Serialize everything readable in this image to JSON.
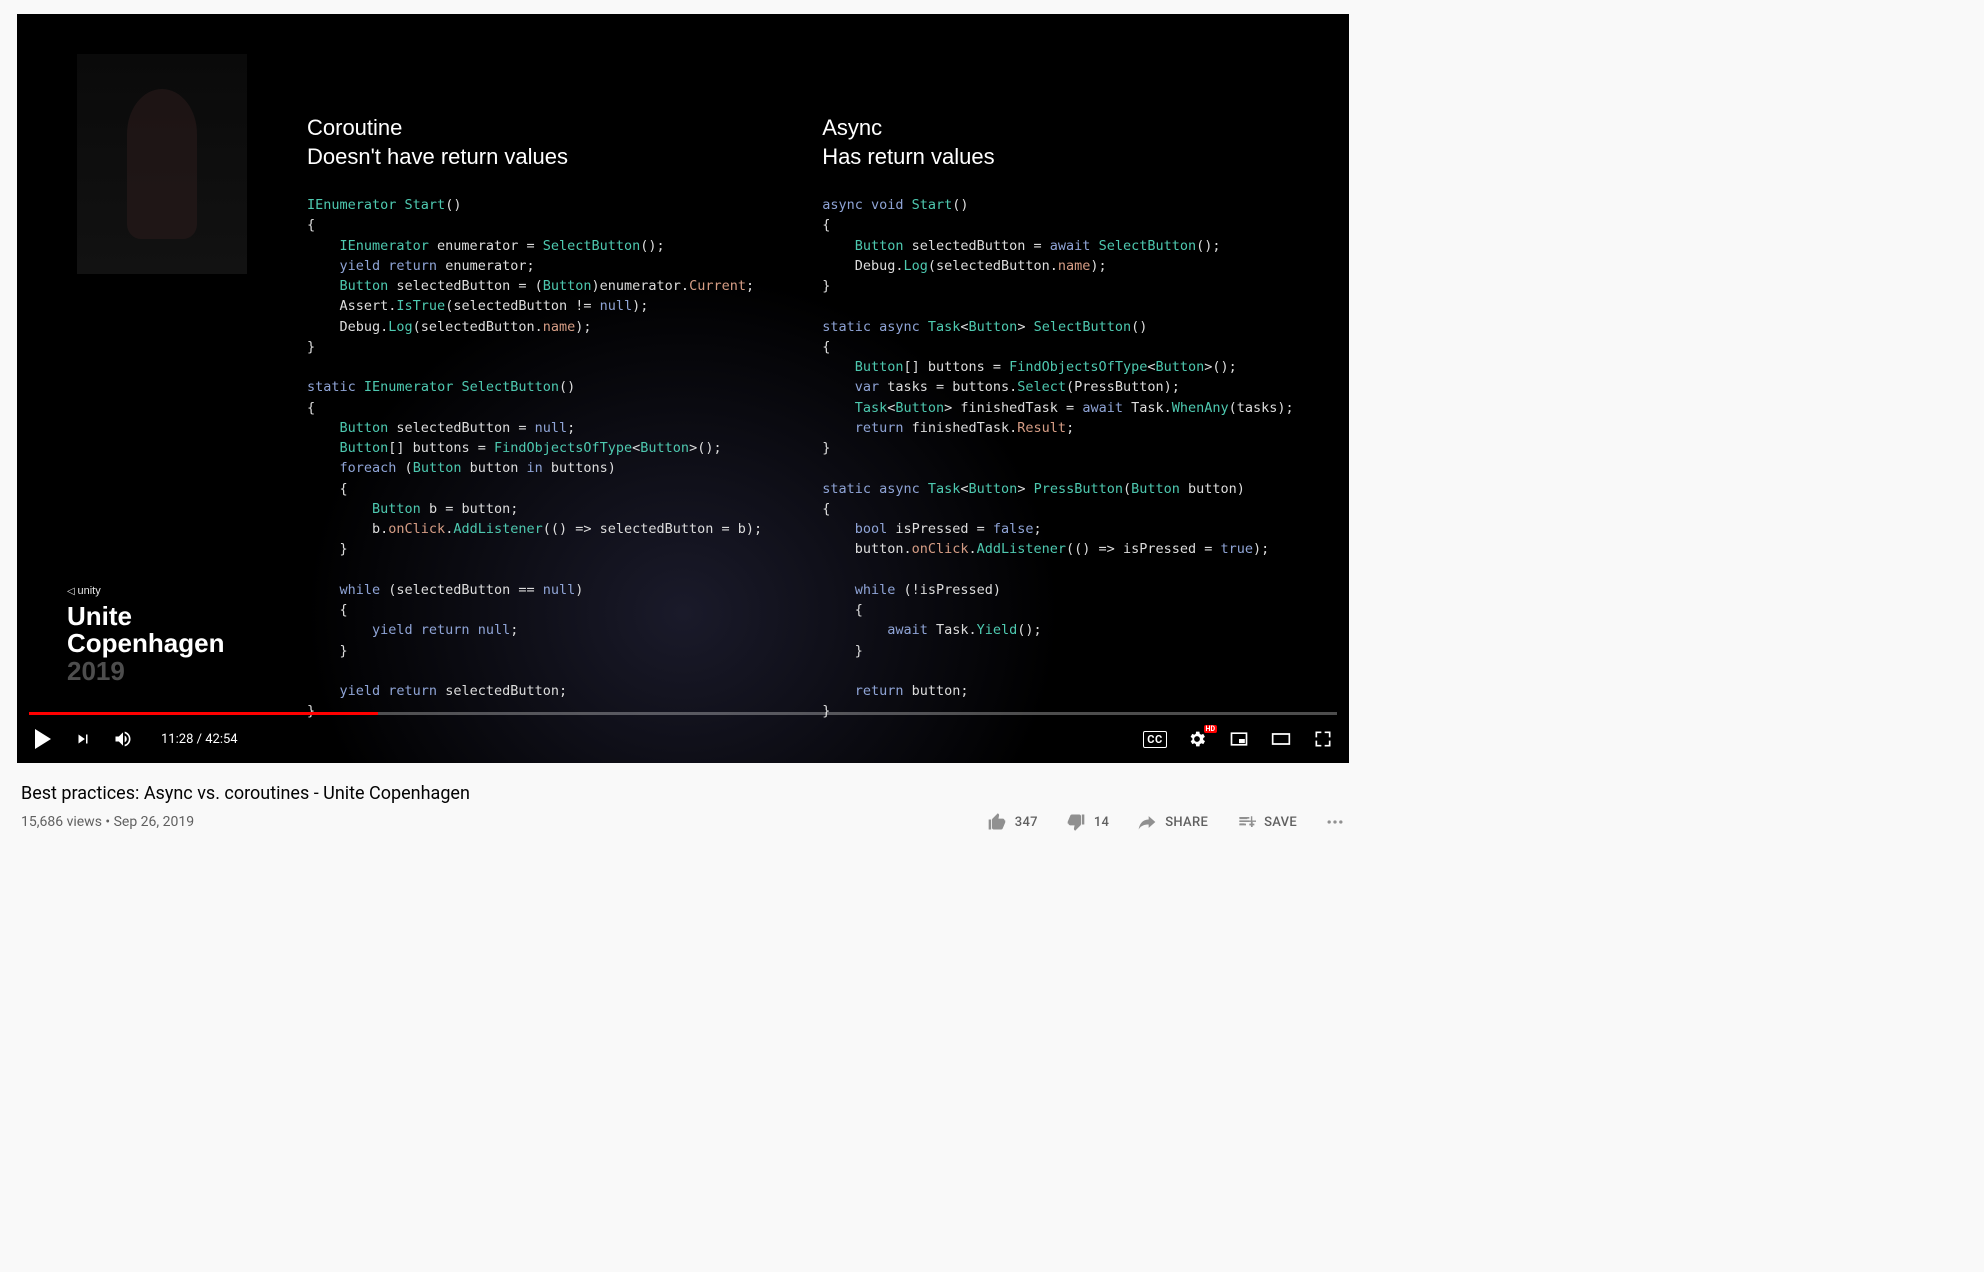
{
  "player": {
    "time_current": "11:28",
    "time_total": "42:54",
    "progress_pct": 26.7,
    "cc_label": "CC"
  },
  "slide": {
    "left_title": "Coroutine",
    "left_subtitle": "Doesn't have return values",
    "right_title": "Async",
    "right_subtitle": "Has return values",
    "code_left": "IEnumerator Start()\n{\n    IEnumerator enumerator = SelectButton();\n    yield return enumerator;\n    Button selectedButton = (Button)enumerator.Current;\n    Assert.IsTrue(selectedButton != null);\n    Debug.Log(selectedButton.name);\n}\n\nstatic IEnumerator SelectButton()\n{\n    Button selectedButton = null;\n    Button[] buttons = FindObjectsOfType<Button>();\n    foreach (Button button in buttons)\n    {\n        Button b = button;\n        b.onClick.AddListener(() => selectedButton = b);\n    }\n\n    while (selectedButton == null)\n    {\n        yield return null;\n    }\n\n    yield return selectedButton;\n}",
    "code_right": "async void Start()\n{\n    Button selectedButton = await SelectButton();\n    Debug.Log(selectedButton.name);\n}\n\nstatic async Task<Button> SelectButton()\n{\n    Button[] buttons = FindObjectsOfType<Button>();\n    var tasks = buttons.Select(PressButton);\n    Task<Button> finishedTask = await Task.WhenAny(tasks);\n    return finishedTask.Result;\n}\n\nstatic async Task<Button> PressButton(Button button)\n{\n    bool isPressed = false;\n    button.onClick.AddListener(() => isPressed = true);\n\n    while (!isPressed)\n    {\n        await Task.Yield();\n    }\n\n    return button;\n}"
  },
  "branding": {
    "logo": "unity",
    "line1": "Unite",
    "line2": "Copenhagen",
    "line3": "2019"
  },
  "info": {
    "title": "Best practices: Async vs. coroutines - Unite Copenhagen",
    "views": "15,686 views",
    "date": "Sep 26, 2019",
    "likes": "347",
    "dislikes": "14",
    "share": "SHARE",
    "save": "SAVE"
  }
}
